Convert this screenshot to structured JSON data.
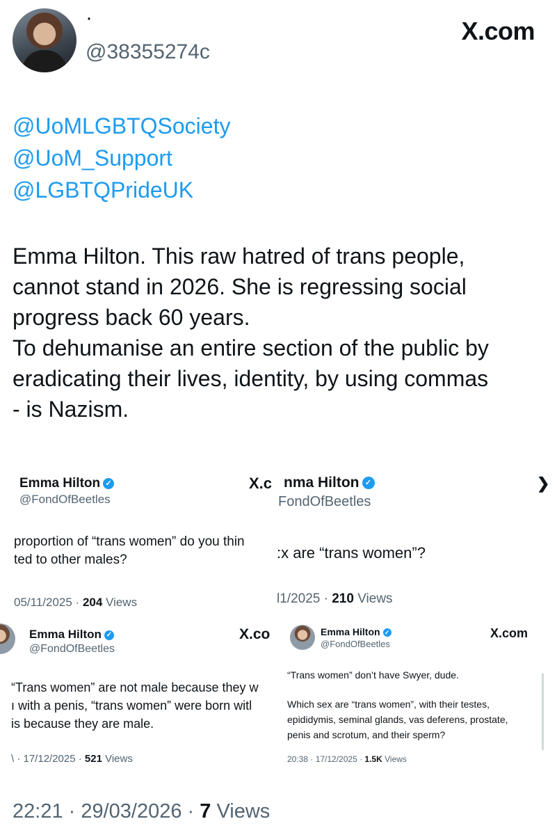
{
  "header": {
    "display_name": "·",
    "handle": "@38355274c",
    "brand": "X.com"
  },
  "mentions": [
    "@UoMLGBTQSociety",
    "@UoM_Support",
    "@LGBTQPrideUK"
  ],
  "tweet_lines": [
    "Emma Hilton.  This raw hatred of trans people,",
    "cannot stand in 2026. She is regressing social",
    "progress back 60 years.",
    "To dehumanise an entire section of the public by",
    "eradicating their lives, identity, by using commas",
    "- is Nazism."
  ],
  "embedded": {
    "card1": {
      "name": "Emma Hilton",
      "handle": "@FondOfBeetles",
      "brand": "X.c",
      "line1": "proportion of “trans women” do you thin",
      "line2": "ted to other males?",
      "date": "05/11/2025 · ",
      "views_count": "204",
      "views_label": " Views"
    },
    "card2": {
      "name": "nma Hilton",
      "handle": "FondOfBeetles",
      "brand": "❯",
      "line1": ":x are “trans women”?",
      "date": "l1/2025 · ",
      "views_count": "210",
      "views_label": " Views"
    },
    "card3": {
      "name": "Emma Hilton",
      "handle": "@FondOfBeetles",
      "brand": "X.co",
      "line1": "“Trans women” are not male because they w",
      "line2": "ı with a penis, “trans women” were born witl",
      "line3": "is because they are male.",
      "date": "\\ · 17/12/2025 · ",
      "views_count": "521",
      "views_label": " Views"
    },
    "card4": {
      "name": "Emma Hilton",
      "handle": "@FondOfBeetles",
      "brand": "X.com",
      "line1": "“Trans women” don’t have Swyer, dude.",
      "line2": "Which sex are “trans women”, with their testes,",
      "line3": "epididymis, seminal glands, vas deferens, prostate,",
      "line4": "penis and scrotum, and their sperm?",
      "date": "20:38 · 17/12/2025 · ",
      "views_count": "1.5K",
      "views_label": " Views"
    }
  },
  "footer": {
    "time_date": "22:21 · 29/03/2026 · ",
    "views_count": "7",
    "views_label": " Views"
  },
  "colors": {
    "link": "#1d9bf0",
    "text": "#0f1419",
    "muted": "#536471",
    "verified": "#1d9bf0"
  }
}
